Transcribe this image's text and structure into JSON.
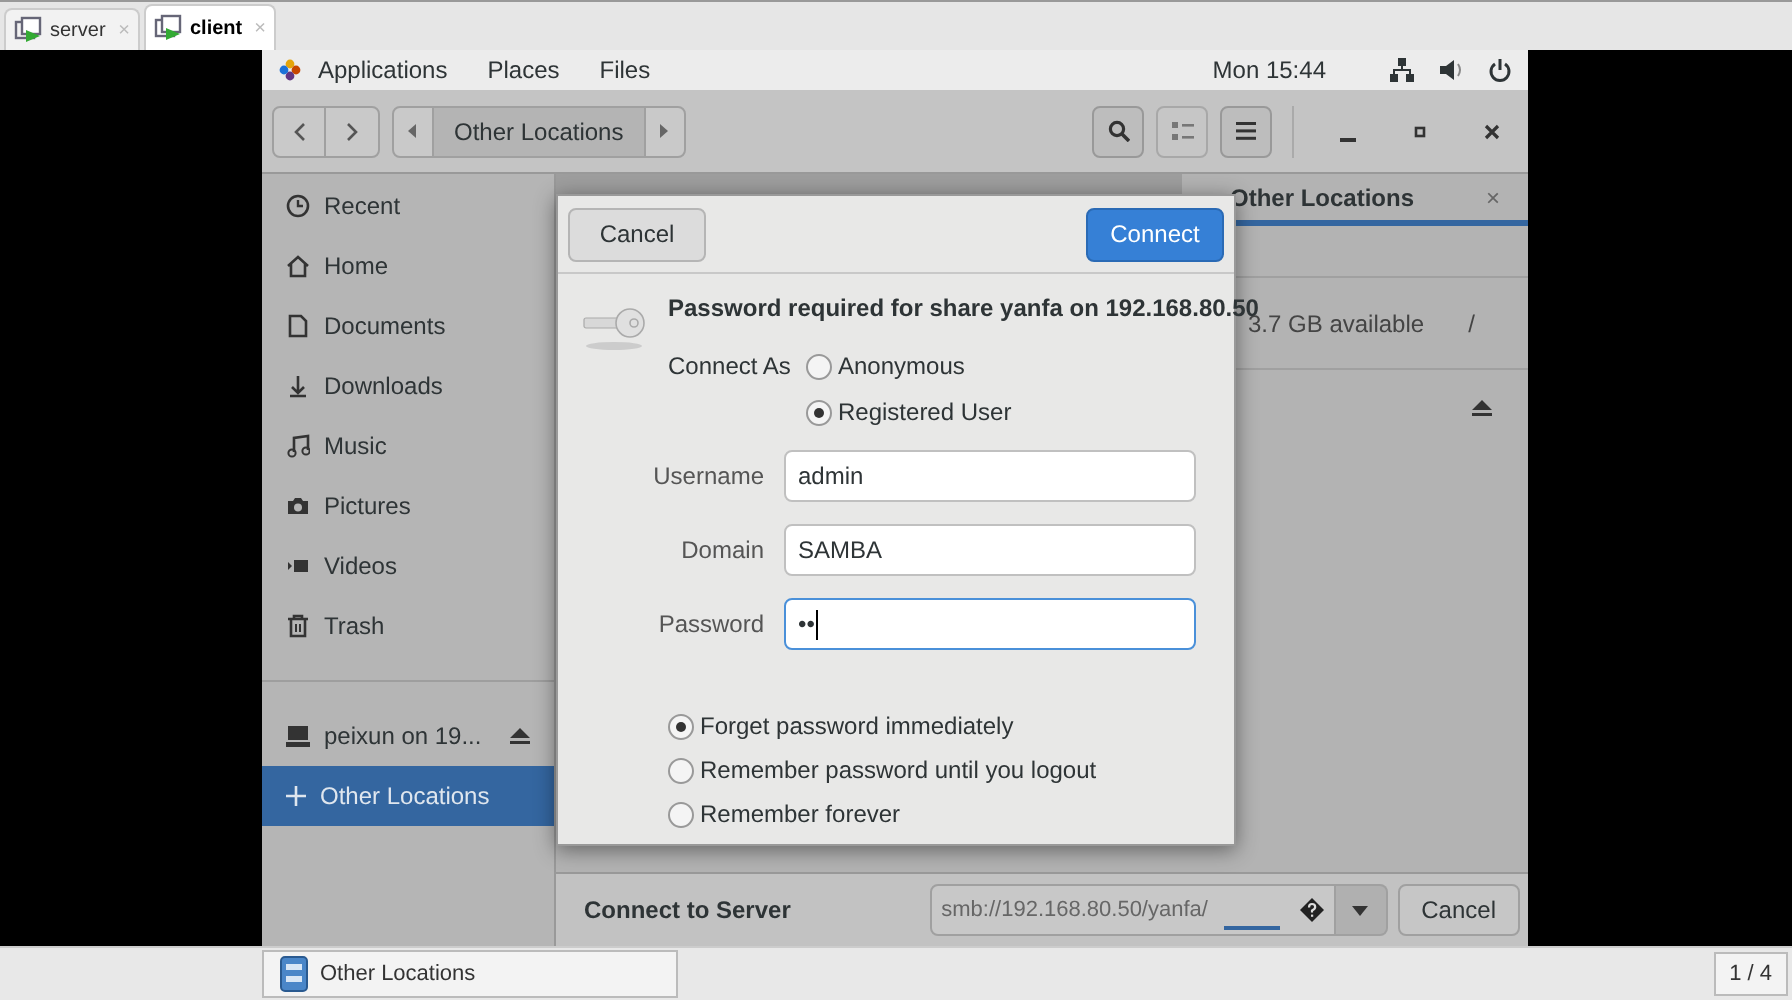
{
  "browser_tabs": [
    {
      "label": "server",
      "selected": false,
      "close": "×"
    },
    {
      "label": "client",
      "selected": true,
      "close": "×"
    }
  ],
  "top_panel": {
    "menus": [
      "Applications",
      "Places",
      "Files"
    ],
    "clock": "Mon 15:44"
  },
  "headerbar": {
    "path": "Other Locations"
  },
  "sidebar": {
    "items": [
      {
        "label": "Recent",
        "selected": false,
        "kind": "place"
      },
      {
        "label": "Home",
        "selected": false,
        "kind": "place"
      },
      {
        "label": "Documents",
        "selected": false,
        "kind": "place"
      },
      {
        "label": "Downloads",
        "selected": false,
        "kind": "place"
      },
      {
        "label": "Music",
        "selected": false,
        "kind": "place"
      },
      {
        "label": "Pictures",
        "selected": false,
        "kind": "place"
      },
      {
        "label": "Videos",
        "selected": false,
        "kind": "place"
      },
      {
        "label": "Trash",
        "selected": false,
        "kind": "place"
      },
      {
        "label": "peixun on 19...",
        "selected": false,
        "kind": "mount"
      },
      {
        "label": "Other Locations",
        "selected": true,
        "kind": "other"
      }
    ]
  },
  "view_tab": {
    "label": "Other Locations",
    "close": "×"
  },
  "location": {
    "free": "3.7 GB available",
    "path": "/"
  },
  "dialog": {
    "cancel": "Cancel",
    "connect": "Connect",
    "message": "Password required for share yanfa on 192.168.80.50",
    "connect_as_label": "Connect As",
    "connect_as": [
      {
        "label": "Anonymous",
        "selected": false
      },
      {
        "label": "Registered User",
        "selected": true
      }
    ],
    "fields": [
      {
        "label": "Username",
        "value": "admin",
        "focused": false
      },
      {
        "label": "Domain",
        "value": "SAMBA",
        "focused": false
      },
      {
        "label": "Password",
        "value": "••",
        "focused": true
      }
    ],
    "remember": [
      {
        "label": "Forget password immediately",
        "selected": true
      },
      {
        "label": "Remember password until you logout",
        "selected": false
      },
      {
        "label": "Remember forever",
        "selected": false
      }
    ]
  },
  "connect_bar": {
    "title": "Connect to Server",
    "address": "smb://192.168.80.50/yanfa/",
    "cancel": "Cancel"
  },
  "taskbar": {
    "window": "Other Locations",
    "workspace": "1 / 4"
  }
}
